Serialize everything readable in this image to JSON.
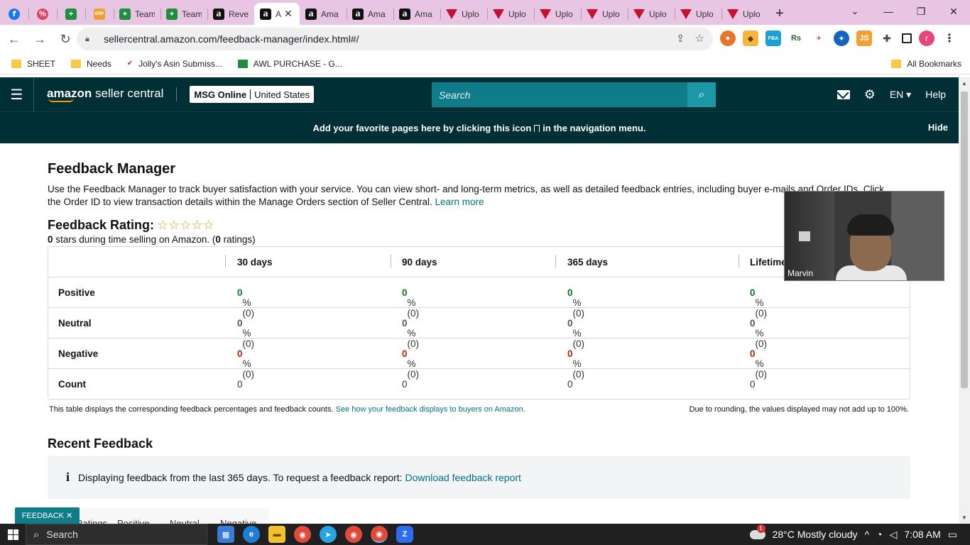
{
  "browser": {
    "tabs": [
      {
        "icon": "facebook-icon",
        "label": "",
        "pinned": true
      },
      {
        "icon": "percent-icon",
        "label": "",
        "pinned": true
      },
      {
        "icon": "sheets-icon",
        "label": "",
        "pinned": true
      },
      {
        "icon": "erp-icon",
        "label": "",
        "pinned": true
      },
      {
        "icon": "sheets-icon",
        "label": "Team"
      },
      {
        "icon": "sheets-icon",
        "label": "Team"
      },
      {
        "icon": "amazon-icon",
        "label": "Reve"
      },
      {
        "icon": "amazon-icon",
        "label": "A",
        "active": true
      },
      {
        "icon": "amazon-icon",
        "label": "Ama"
      },
      {
        "icon": "amazon-icon",
        "label": "Ama"
      },
      {
        "icon": "amazon-icon",
        "label": "Ama"
      },
      {
        "icon": "upload-icon",
        "label": "Uplo"
      },
      {
        "icon": "upload-icon",
        "label": "Uplo"
      },
      {
        "icon": "upload-icon",
        "label": "Uplo"
      },
      {
        "icon": "upload-icon",
        "label": "Uplo"
      },
      {
        "icon": "upload-icon",
        "label": "Uplo"
      },
      {
        "icon": "upload-icon",
        "label": "Uplo"
      },
      {
        "icon": "upload-icon",
        "label": "Uplo"
      }
    ],
    "url": "sellercentral.amazon.com/feedback-manager/index.html#/",
    "bookmarks": [
      "SHEET",
      "Needs",
      "Jolly's Asin Submiss...",
      "AWL PURCHASE - G..."
    ],
    "all_bookmarks": "All Bookmarks",
    "profile_initial": "r",
    "colors": {
      "tabstrip": "#e8c6e3",
      "accent": "#002f36"
    }
  },
  "header": {
    "logo_bold": "amazon",
    "logo_rest": " seller central",
    "store_name": "MSG Online",
    "store_region": "United States",
    "search_placeholder": "Search",
    "language": "EN",
    "help": "Help"
  },
  "banner": {
    "text_before": "Add your favorite pages here by clicking this icon",
    "text_after": "in the navigation menu.",
    "hide": "Hide"
  },
  "page": {
    "title": "Feedback Manager",
    "intro": "Use the Feedback Manager to track buyer satisfaction with your service. You can view short- and long-term metrics, as well as detailed feedback entries, including buyer e-mails and Order IDs. Click the Order ID to view transaction details within the Manage Orders section of Seller Central.",
    "learn_more": "Learn more",
    "rating_title": "Feedback Rating:",
    "stars": "☆☆☆☆☆",
    "rating_stars_value": "0",
    "rating_sub_mid": " stars during time selling on Amazon. (",
    "rating_count": "0",
    "rating_sub_end": " ratings)"
  },
  "table": {
    "headers": [
      "30 days",
      "90 days",
      "365 days",
      "Lifetime"
    ],
    "rows": [
      {
        "label": "Positive",
        "values": [
          "0",
          "0",
          "0",
          "0"
        ],
        "suffix": "%(0)"
      },
      {
        "label": "Neutral",
        "values": [
          "0",
          "0",
          "0",
          "0"
        ],
        "suffix": "%(0)"
      },
      {
        "label": "Negative",
        "values": [
          "0",
          "0",
          "0",
          "0"
        ],
        "suffix": "%(0)"
      },
      {
        "label": "Count",
        "values": [
          "0",
          "0",
          "0",
          "0"
        ]
      }
    ],
    "note": "This table displays the corresponding feedback percentages and feedback counts.",
    "note_link": "See how your feedback displays to buyers on Amazon.",
    "note_right": "Due to rounding, the values displayed may not add up to 100%."
  },
  "recent": {
    "title": "Recent Feedback",
    "info_text": "Displaying feedback from the last 365 days. To request a feedback report:",
    "info_link": "Download feedback report",
    "tabs": [
      "Ratings",
      "Positive",
      "Neutral",
      "Negative"
    ]
  },
  "feedback_pill": "FEEDBACK ✕",
  "video": {
    "name": "Marvin"
  },
  "taskbar": {
    "search": "Search",
    "weather": "28°C  Mostly cloudy",
    "weather_badge": "1",
    "time": "7:08 AM"
  }
}
